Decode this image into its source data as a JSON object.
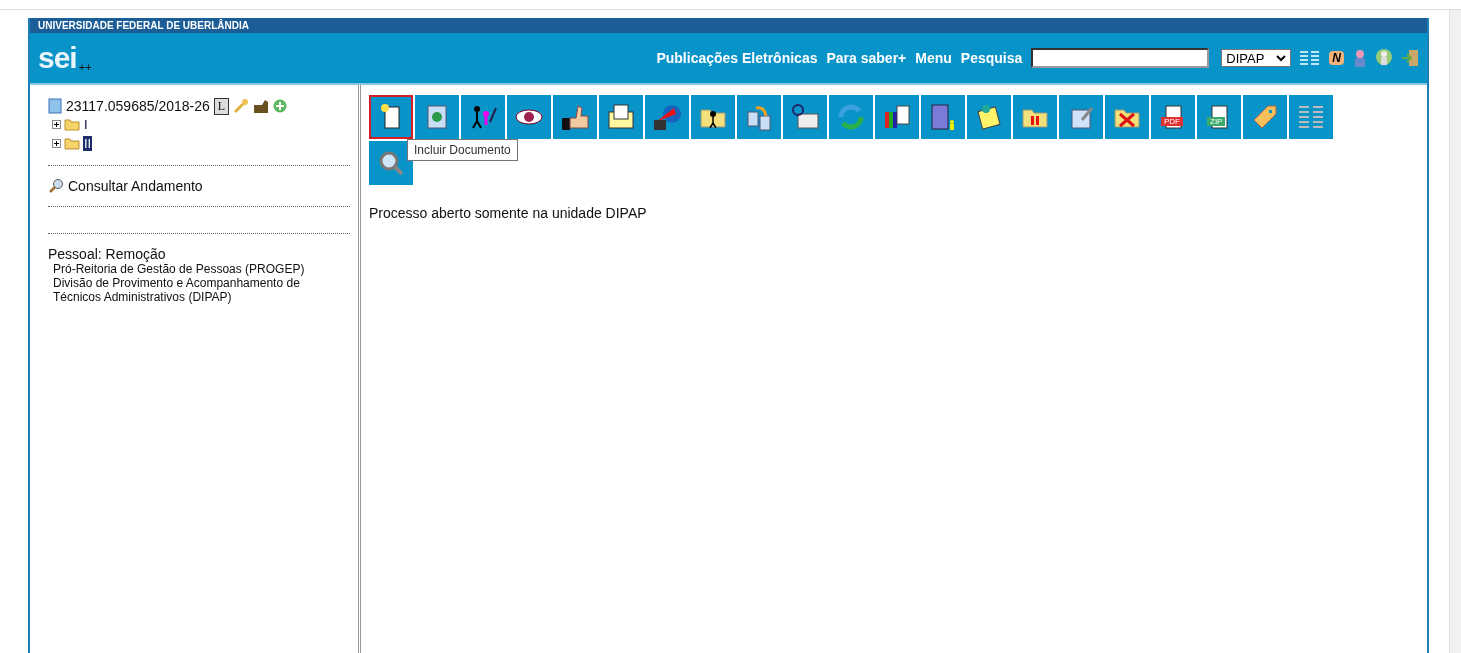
{
  "header": {
    "institution": "UNIVERSIDADE FEDERAL DE UBERLÂNDIA",
    "logo": "sei",
    "logo_suffix": "++",
    "links": [
      "Publicações Eletrônicas",
      "Para saber+",
      "Menu",
      "Pesquisa"
    ],
    "unit_select": {
      "value": "DIPAP"
    },
    "badge": "N"
  },
  "tree": {
    "process": "23117.059685/2018-26",
    "marker": "L",
    "children": [
      {
        "label": "I",
        "selected": false
      },
      {
        "label": "II",
        "selected": true
      }
    ]
  },
  "sidebar": {
    "consult_link": "Consultar Andamento",
    "info_title": "Pessoal: Remoção",
    "info_lines": [
      "Pró-Reitoria de Gestão de Pessoas (PROGEP)",
      "Divisão de Provimento e Acompanhamento de",
      "Técnicos Administrativos (DIPAP)"
    ]
  },
  "toolbar": {
    "buttons": [
      {
        "selected": true
      },
      {
        "selected": false
      },
      {
        "selected": false
      },
      {
        "selected": false
      },
      {
        "selected": false
      },
      {
        "selected": false
      },
      {
        "selected": false
      },
      {
        "selected": false
      },
      {
        "selected": false
      },
      {
        "selected": false
      },
      {
        "selected": false
      },
      {
        "selected": false
      },
      {
        "selected": false
      },
      {
        "selected": false
      },
      {
        "selected": false
      },
      {
        "selected": false
      },
      {
        "selected": false
      },
      {
        "selected": false,
        "label": "PDF"
      },
      {
        "selected": false,
        "label": "ZIP"
      },
      {
        "selected": false
      },
      {
        "selected": false
      },
      {
        "selected": false
      }
    ],
    "tooltip": "Incluir Documento"
  },
  "message": "Processo aberto somente na unidade DIPAP"
}
